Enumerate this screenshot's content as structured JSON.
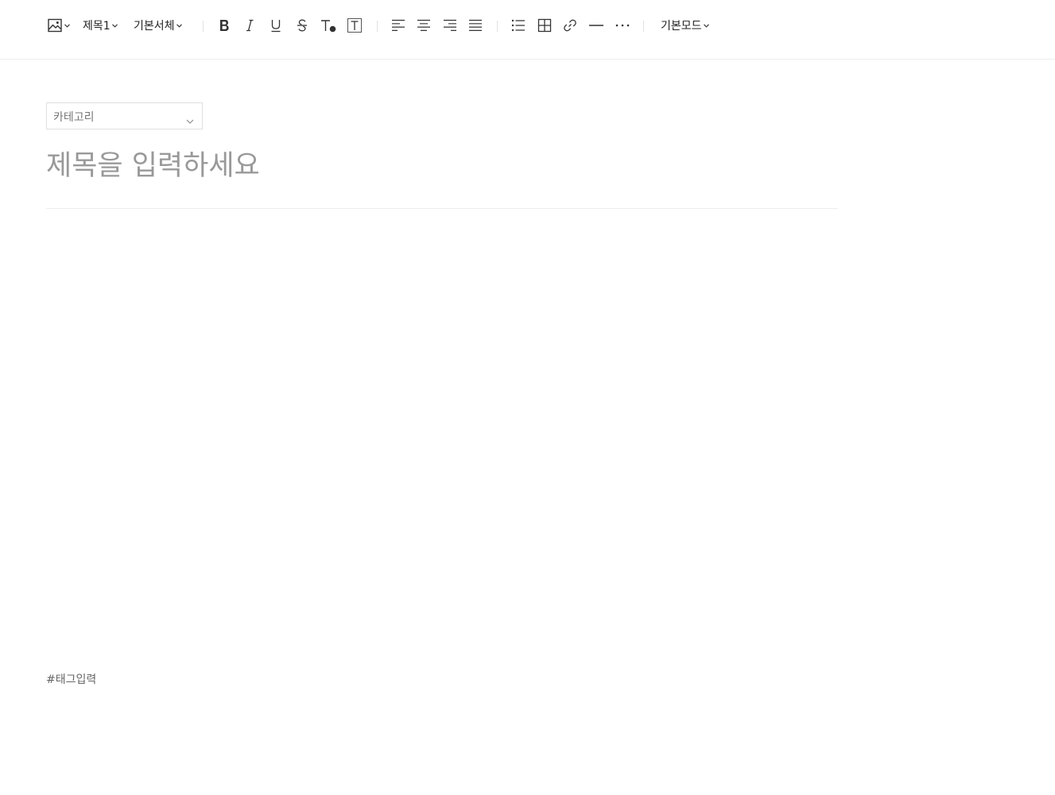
{
  "toolbar": {
    "image_icon": "image-icon",
    "heading_select": "제목1",
    "font_select": "기본서체",
    "mode_select": "기본모드",
    "icons": {
      "bold": "bold-icon",
      "italic": "italic-icon",
      "underline": "underline-icon",
      "strikethrough": "strikethrough-icon",
      "text_color": "text-color-icon",
      "text_background": "text-background-icon",
      "align_left": "align-left-icon",
      "align_center": "align-center-icon",
      "align_right": "align-right-icon",
      "align_justify": "align-justify-icon",
      "bullet_list": "bullet-list-icon",
      "table": "table-icon",
      "link": "link-icon",
      "horizontal_rule": "horizontal-rule-icon",
      "more": "more-icon"
    }
  },
  "editor": {
    "category_placeholder": "카테고리",
    "title_placeholder": "제목을 입력하세요",
    "tag_placeholder": "#태그입력"
  },
  "colors": {
    "icon": "#333333",
    "placeholder_title": "#999999",
    "border": "#e0e0e0"
  }
}
